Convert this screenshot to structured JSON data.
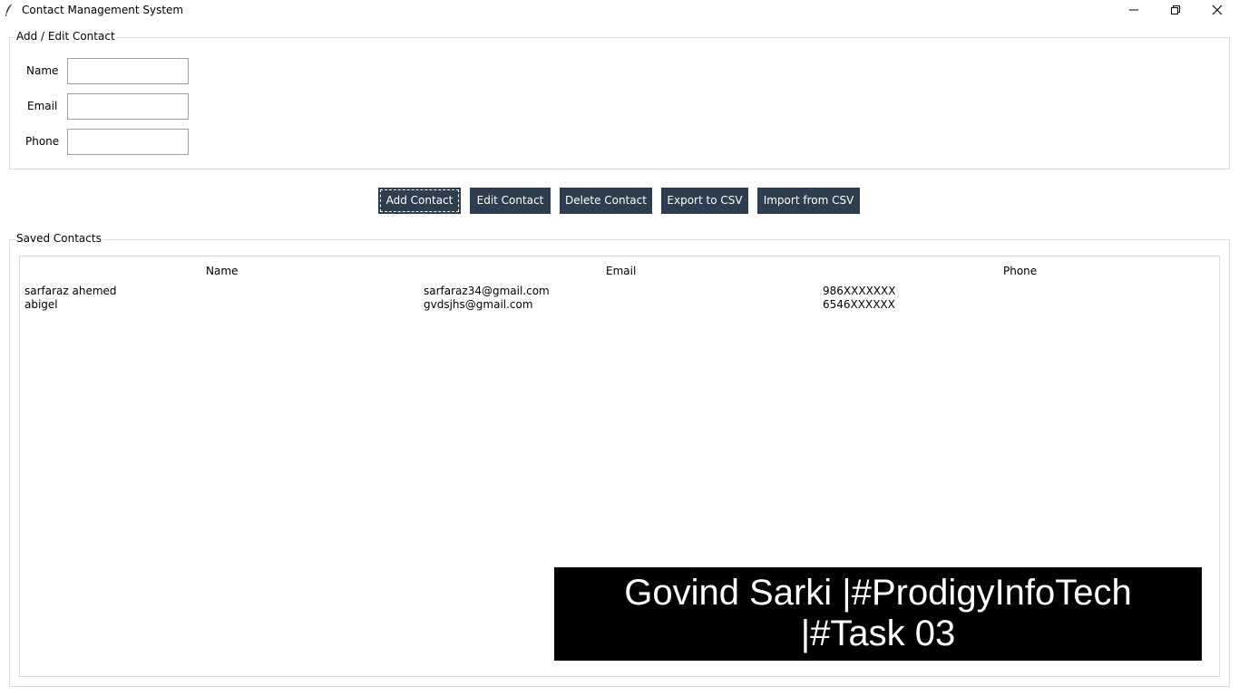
{
  "window": {
    "title": "Contact Management System",
    "icon": "feather-icon",
    "controls": [
      "minimize-icon",
      "restore-icon",
      "close-icon"
    ]
  },
  "form": {
    "legend": "Add / Edit Contact",
    "fields": [
      {
        "label": "Name",
        "value": "",
        "placeholder": ""
      },
      {
        "label": "Email",
        "value": "",
        "placeholder": ""
      },
      {
        "label": "Phone",
        "value": "",
        "placeholder": ""
      }
    ]
  },
  "toolbar": {
    "buttons": [
      {
        "label": "Add Contact",
        "focused": true
      },
      {
        "label": "Edit Contact"
      },
      {
        "label": "Delete Contact"
      },
      {
        "label": "Export to CSV"
      },
      {
        "label": "Import from CSV"
      }
    ],
    "button_color": "#2c3e50"
  },
  "contacts": {
    "legend": "Saved Contacts",
    "columns": [
      "Name",
      "Email",
      "Phone"
    ],
    "rows": [
      [
        "sarfaraz ahemed",
        "sarfaraz34@gmail.com",
        "986XXXXXXX"
      ],
      [
        "abigel",
        "gvdsjhs@gmail.com",
        "6546XXXXXX"
      ]
    ]
  },
  "overlay": {
    "line1": "Govind Sarki |#ProdigyInfoTech",
    "line2": "|#Task 03"
  }
}
